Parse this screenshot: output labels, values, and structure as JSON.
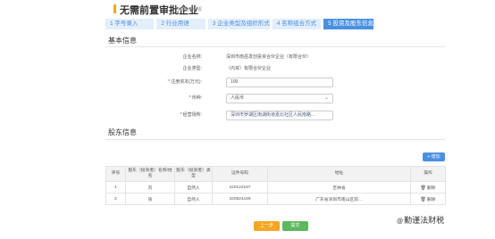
{
  "header": {
    "title": "无需前置审批企业",
    "subtitle": "名称自主申报"
  },
  "steps": [
    {
      "label": "1 字号录入",
      "active": false
    },
    {
      "label": "2 行业用语",
      "active": false
    },
    {
      "label": "3 企业类型及组织形式",
      "active": false
    },
    {
      "label": "4 名称组合方式",
      "active": false
    },
    {
      "label": "5 投资及股东信息",
      "active": true
    }
  ],
  "basic_info": {
    "section_title": "基本信息",
    "company_name": {
      "label": "企业名称:",
      "value": "深圳市南岳发创投资合伙企业（有限合伙）"
    },
    "company_type": {
      "label": "企业类型:",
      "value": "（内资）有限合伙企业"
    },
    "capital": {
      "label": "注册资本(万元):",
      "value": "100"
    },
    "currency": {
      "label": "币种:",
      "value": "人民币"
    },
    "address": {
      "label": "经营场所:",
      "value": "深圳市罗湖区南湖街道嘉北社区人民南路…"
    }
  },
  "shareholders": {
    "section_title": "股东信息",
    "add_label": "+ 增加",
    "columns": [
      "序号",
      "股东（投资者）名称/姓名",
      "股东（投资者）类型",
      "证件号码",
      "地址",
      "操作"
    ],
    "rows": [
      {
        "no": "1",
        "name": "刘",
        "type": "自然人",
        "id": "220122197",
        "address": "吉林省",
        "action": "删除"
      },
      {
        "no": "2",
        "name": "张",
        "type": "自然人",
        "id": "340824199",
        "address": "广东省深圳市南山区前…",
        "action": "删除"
      }
    ]
  },
  "footer": {
    "prev_label": "上一步",
    "submit_label": "提交"
  },
  "watermark": {
    "at": "@",
    "text": "勤谨法财税"
  },
  "colors": {
    "accent": "#4a90e2",
    "step_inactive_bg": "#e3eefb",
    "prev_button": "#f5a623",
    "submit_button": "#5cb85c",
    "required": "#e02020"
  }
}
